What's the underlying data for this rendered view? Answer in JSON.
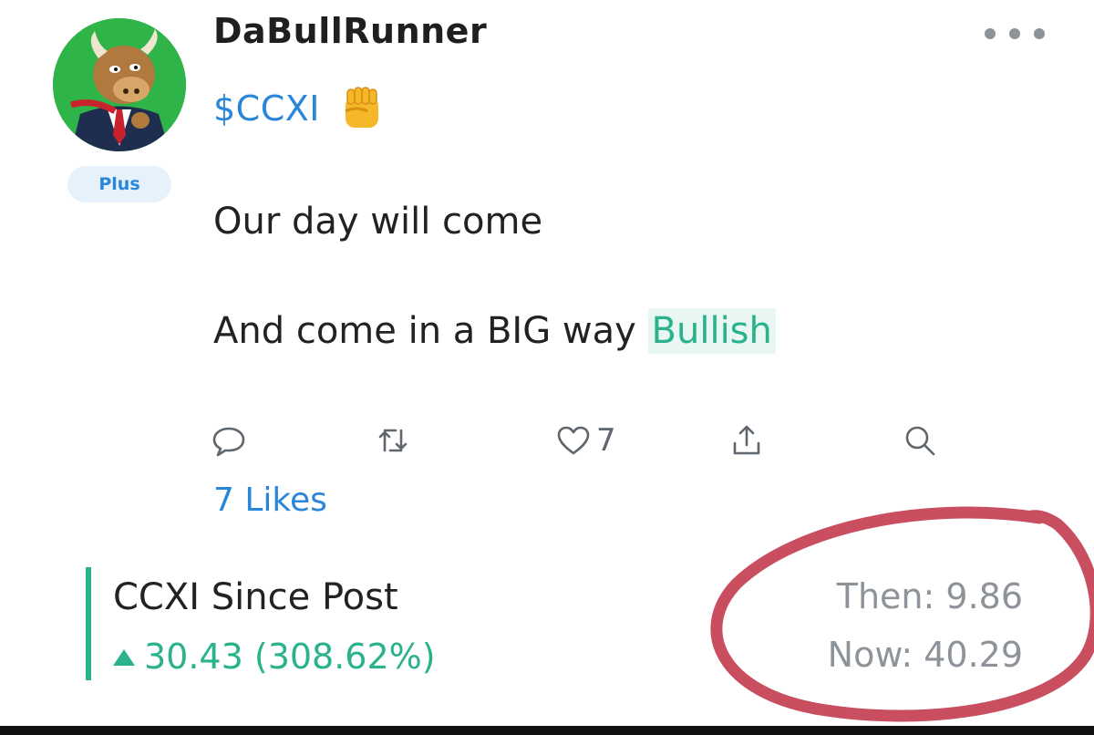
{
  "post": {
    "username": "DaBullRunner",
    "badge": "Plus",
    "ticker": "$CCXI",
    "emoji_icon": "raised-fist-icon",
    "line1": "Our day will come",
    "line2_prefix": "And come in a BIG way ",
    "sentiment": "Bullish",
    "like_count": "7",
    "likes_text": "7 Likes"
  },
  "performance": {
    "title": "CCXI Since Post",
    "change": "30.43 (308.62%)",
    "then": "Then: 9.86",
    "now": "Now: 40.29"
  },
  "colors": {
    "accent_blue": "#2a86d9",
    "bull_green": "#2ab28c",
    "annotation_red": "#c23b4f",
    "avatar_green": "#2fb44a"
  },
  "icons": {
    "comment": "comment-icon",
    "reshare": "reshare-icon",
    "like": "heart-icon",
    "share": "share-icon",
    "search": "search-icon",
    "more": "more-dots-icon"
  }
}
